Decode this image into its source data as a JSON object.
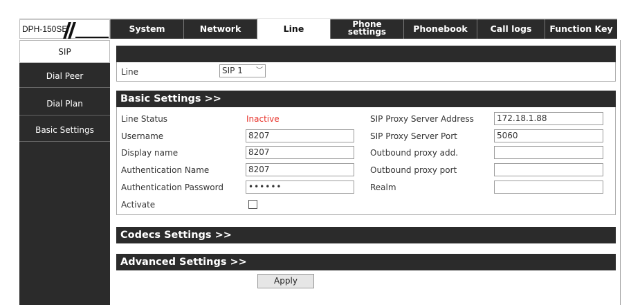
{
  "logo": {
    "model": "DPH-150SE"
  },
  "nav": {
    "tabs": [
      {
        "label": "System"
      },
      {
        "label": "Network"
      },
      {
        "label": "Line"
      },
      {
        "label_line1": "Phone",
        "label_line2": "settings"
      },
      {
        "label": "Phonebook"
      },
      {
        "label": "Call logs"
      },
      {
        "label": "Function Key"
      }
    ],
    "active": "Line"
  },
  "sidebar": {
    "items": [
      {
        "label": "SIP"
      },
      {
        "label": "Dial Peer"
      },
      {
        "label": "Dial Plan"
      },
      {
        "label": "Basic Settings"
      }
    ],
    "active": "SIP"
  },
  "line_select": {
    "label": "Line",
    "value": "SIP 1",
    "icon": "chevron-down-icon"
  },
  "basic": {
    "title": "Basic Settings >>",
    "left": {
      "line_status_label": "Line Status",
      "line_status_value": "Inactive",
      "username_label": "Username",
      "username_value": "8207",
      "display_name_label": "Display name",
      "display_name_value": "8207",
      "auth_name_label": "Authentication Name",
      "auth_name_value": "8207",
      "auth_password_label": "Authentication Password",
      "auth_password_value": "••••••",
      "activate_label": "Activate"
    },
    "right": {
      "proxy_address_label": "SIP Proxy Server Address",
      "proxy_address_value": "172.18.1.88",
      "proxy_port_label": "SIP Proxy Server Port",
      "proxy_port_value": "5060",
      "outbound_add_label": "Outbound proxy add.",
      "outbound_add_value": "",
      "outbound_port_label": "Outbound proxy port",
      "outbound_port_value": "",
      "realm_label": "Realm",
      "realm_value": ""
    }
  },
  "codecs": {
    "title": "Codecs Settings >>"
  },
  "advanced": {
    "title": "Advanced Settings >>"
  },
  "apply_label": "Apply",
  "colors": {
    "dark": "#2b2b2b",
    "inactive": "#e8322a"
  }
}
